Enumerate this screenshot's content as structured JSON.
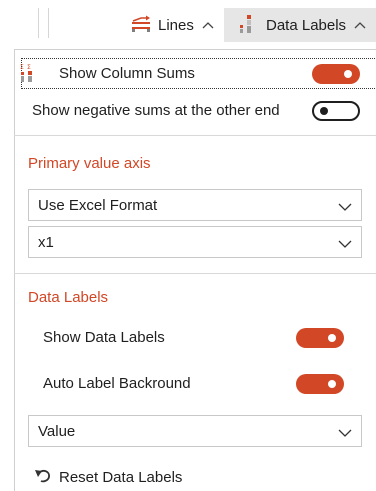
{
  "toolbar": {
    "lines_label": "Lines",
    "data_labels_label": "Data Labels",
    "chevron": "^"
  },
  "options": {
    "show_column_sums": {
      "label": "Show Column Sums",
      "on": true
    },
    "show_negative_sums": {
      "label": "Show negative sums at the other end",
      "on": false
    }
  },
  "primary_value_axis": {
    "heading": "Primary value axis",
    "format_select": {
      "value": "Use Excel Format"
    },
    "multiplier_select": {
      "value": "x1"
    }
  },
  "data_labels": {
    "heading": "Data Labels",
    "show_data_labels": {
      "label": "Show Data Labels",
      "on": true
    },
    "auto_label_background": {
      "label": "Auto Label Backround",
      "on": true
    },
    "value_select": {
      "value": "Value"
    },
    "reset_label": "Reset Data Labels"
  },
  "colors": {
    "accent": "#d24726",
    "selected_tab_bg": "#e6e6e6",
    "text": "#1f1f1f"
  },
  "icons": {
    "lines": "lines-chart-icon",
    "data_labels": "data-labels-chart-icon",
    "column_sums": "column-sums-icon",
    "reset": "undo-arrow-icon",
    "dropdown": "chevron-down-icon"
  }
}
